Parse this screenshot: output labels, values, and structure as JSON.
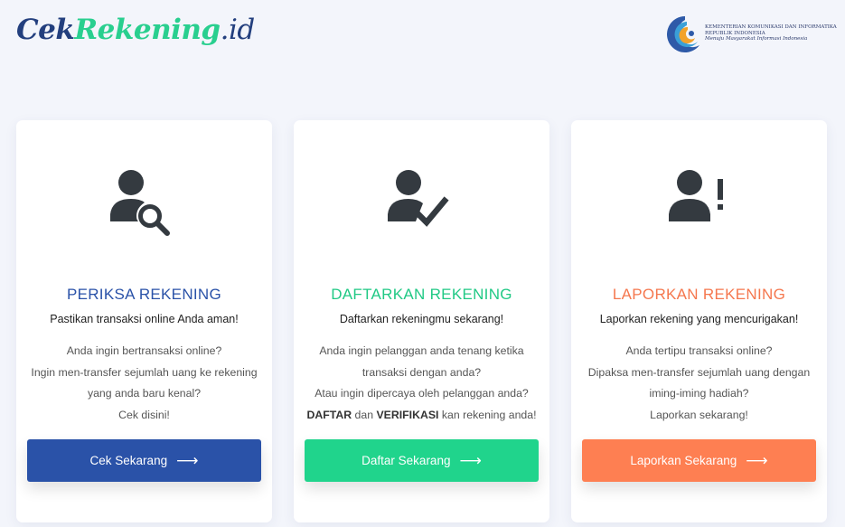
{
  "header": {
    "logo": {
      "part1": "Cek",
      "part2": "Rekening",
      "part3": ".id"
    },
    "kominfo": {
      "line1": "Kementerian Komunikasi dan Informatika",
      "line2": "Republik Indonesia",
      "line3": "Menuju Masyarakat Informasi Indonesia"
    }
  },
  "colors": {
    "blue": "#2a52a8",
    "green": "#20d48c",
    "orange": "#fe7f52",
    "icon": "#343a40"
  },
  "cards": [
    {
      "icon": "user-search-icon",
      "title": "PERIKSA REKENING",
      "subtitle": "Pastikan transaksi online Anda aman!",
      "desc": [
        "Anda ingin bertransaksi online?",
        "Ingin men-transfer sejumlah uang ke rekening",
        "yang anda baru kenal?",
        "Cek disini!"
      ],
      "button": "Cek Sekarang",
      "arrow": "⟶"
    },
    {
      "icon": "user-check-icon",
      "title": "DAFTARKAN REKENING",
      "subtitle": "Daftarkan rekeningmu sekarang!",
      "desc": [
        "Anda ingin pelanggan anda tenang ketika",
        "transaksi dengan anda?",
        "Atau ingin dipercaya oleh pelanggan anda?"
      ],
      "desc_last": {
        "b1": "DAFTAR",
        "t1": " dan ",
        "b2": "VERIFIKASI",
        "t2": " kan rekening anda!"
      },
      "button": "Daftar Sekarang",
      "arrow": "⟶"
    },
    {
      "icon": "user-exclamation-icon",
      "title": "LAPORKAN REKENING",
      "subtitle": "Laporkan rekening yang mencurigakan!",
      "desc": [
        "Anda tertipu transaksi online?",
        "Dipaksa men-transfer sejumlah uang dengan",
        "iming-iming hadiah?",
        "Laporkan sekarang!"
      ],
      "button": "Laporkan Sekarang",
      "arrow": "⟶"
    }
  ]
}
